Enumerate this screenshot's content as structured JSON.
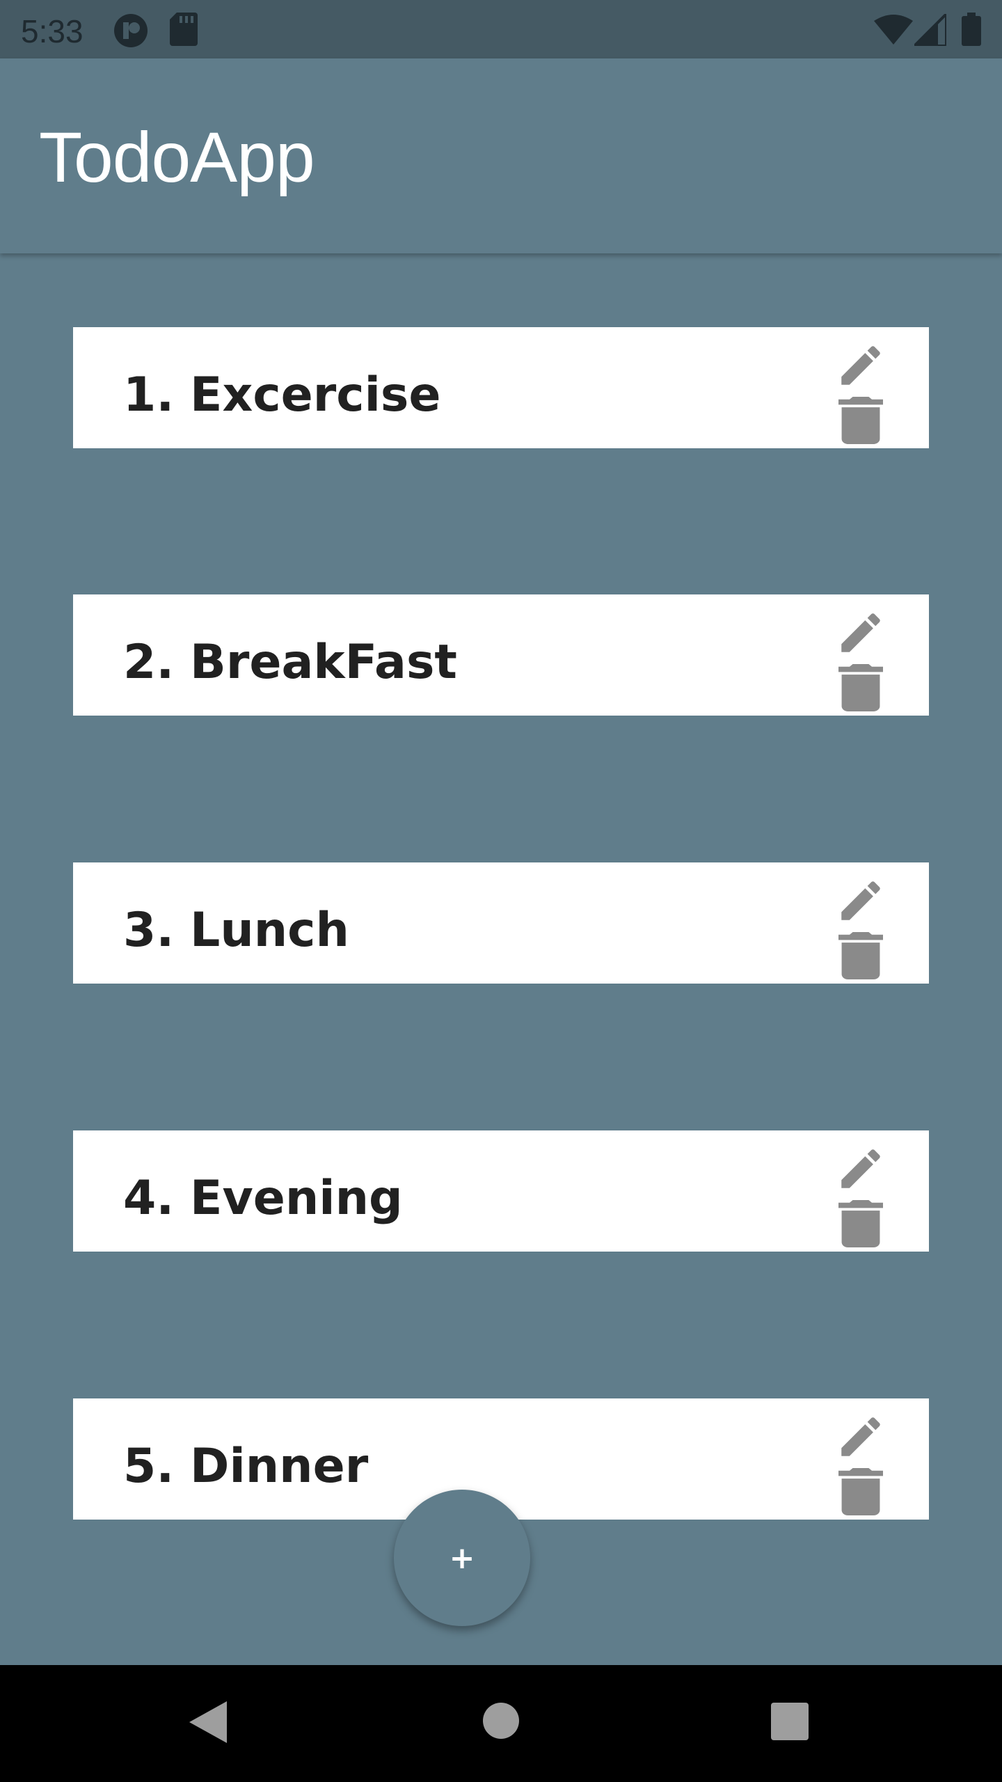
{
  "status_bar": {
    "time": "5:33",
    "icons": [
      "app-notification-icon",
      "sd-card-icon",
      "wifi-icon",
      "cell-signal-icon",
      "battery-icon"
    ]
  },
  "app_bar": {
    "title": "TodoApp"
  },
  "todos": [
    {
      "number": "1.",
      "text": "Excercise"
    },
    {
      "number": "2.",
      "text": "BreakFast"
    },
    {
      "number": "3.",
      "text": "Lunch"
    },
    {
      "number": "4.",
      "text": "Evening"
    },
    {
      "number": "5.",
      "text": "Dinner"
    }
  ],
  "fab": {
    "label": "+"
  },
  "nav_bar": {
    "buttons": [
      "back-icon",
      "home-icon",
      "recents-icon"
    ]
  },
  "colors": {
    "primary": "#607d8b",
    "status_bar": "#455a64",
    "card": "#ffffff",
    "icon_gray": "#8a8a8a"
  }
}
